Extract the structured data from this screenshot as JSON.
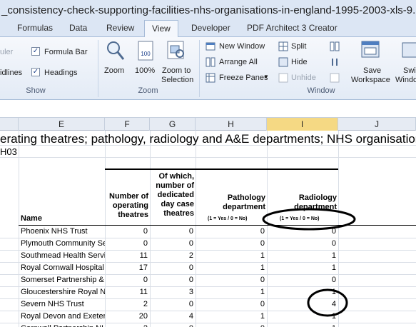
{
  "window": {
    "title": "_consistency-check-supporting-facilities-nhs-organisations-in-england-1995-2003-xls-9..."
  },
  "tabs": [
    "Formulas",
    "Data",
    "Review",
    "View",
    "Developer",
    "PDF Architect 3 Creator"
  ],
  "ribbon": {
    "show": {
      "label": "Show",
      "ruler": "uler",
      "gridlines": "idlines",
      "formula_bar": "Formula Bar",
      "headings": "Headings"
    },
    "zoom": {
      "label": "Zoom",
      "zoom": "Zoom",
      "hundred": "100%",
      "zoom_sel_1": "Zoom to",
      "zoom_sel_2": "Selection"
    },
    "window": {
      "label": "Window",
      "new_window": "New Window",
      "arrange_all": "Arrange All",
      "freeze_panes": "Freeze Panes",
      "split": "Split",
      "hide": "Hide",
      "unhide": "Unhide",
      "save_1": "Save",
      "save_2": "Workspace",
      "switch_1": "Swi",
      "switch_2": "Windo"
    }
  },
  "columns": [
    "E",
    "F",
    "G",
    "H",
    "I",
    "J"
  ],
  "sheet": {
    "title": "erating theatres; pathology, radiology and A&E departments; NHS organisations in E",
    "subtitle": "H03",
    "headers": {
      "name": "Name",
      "theatres": "Number of operating theatres",
      "day_case": "Of which, number of dedicated day case theatres",
      "pathology": "Pathology department",
      "pathology_note": "(1 = Yes / 0 = No)",
      "radiology": "Radiology department",
      "radiology_note": "(1 = Yes / 0 = No)"
    },
    "rows": [
      {
        "name": "Phoenix NHS Trust",
        "f": "0",
        "g": "0",
        "h": "0",
        "i": "0"
      },
      {
        "name": "Plymouth Community Ser",
        "f": "0",
        "g": "0",
        "h": "0",
        "i": "0"
      },
      {
        "name": "Southmead Health Servic",
        "f": "11",
        "g": "2",
        "h": "1",
        "i": "1"
      },
      {
        "name": "Royal Cornwall Hospital",
        "f": "17",
        "g": "0",
        "h": "1",
        "i": "1"
      },
      {
        "name": "Somerset Partnership &",
        "f": "0",
        "g": "0",
        "h": "0",
        "i": "0"
      },
      {
        "name": "Gloucestershire Royal N",
        "f": "11",
        "g": "3",
        "h": "1",
        "i": "1"
      },
      {
        "name": "Severn NHS Trust",
        "f": "2",
        "g": "0",
        "h": "0",
        "i": "4"
      },
      {
        "name": "Royal Devon and Exeter",
        "f": "20",
        "g": "4",
        "h": "1",
        "i": "1"
      },
      {
        "name": "Cornwall Partnership NH",
        "f": "2",
        "g": "0",
        "h": "0",
        "i": "1"
      }
    ]
  }
}
